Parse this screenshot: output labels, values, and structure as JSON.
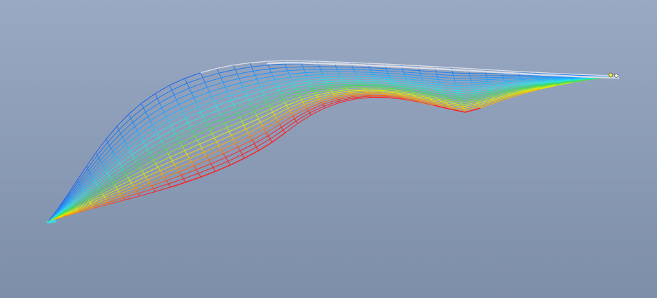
{
  "viewport": {
    "background_top": "#99a9c4",
    "background_bottom": "#7d8ea9"
  },
  "mesh": {
    "type": "wireframe-surface",
    "grid_u": 38,
    "grid_v": 20,
    "colormap": [
      "#1f5fe0",
      "#1fa0ff",
      "#2ee6e6",
      "#3cdc55",
      "#e8f000",
      "#ff9a00",
      "#ff1e1e"
    ],
    "outer_edge_color": "#d9dde6"
  },
  "tool_marker": {
    "colors": [
      "#f5e642",
      "#f0f0f0"
    ]
  }
}
